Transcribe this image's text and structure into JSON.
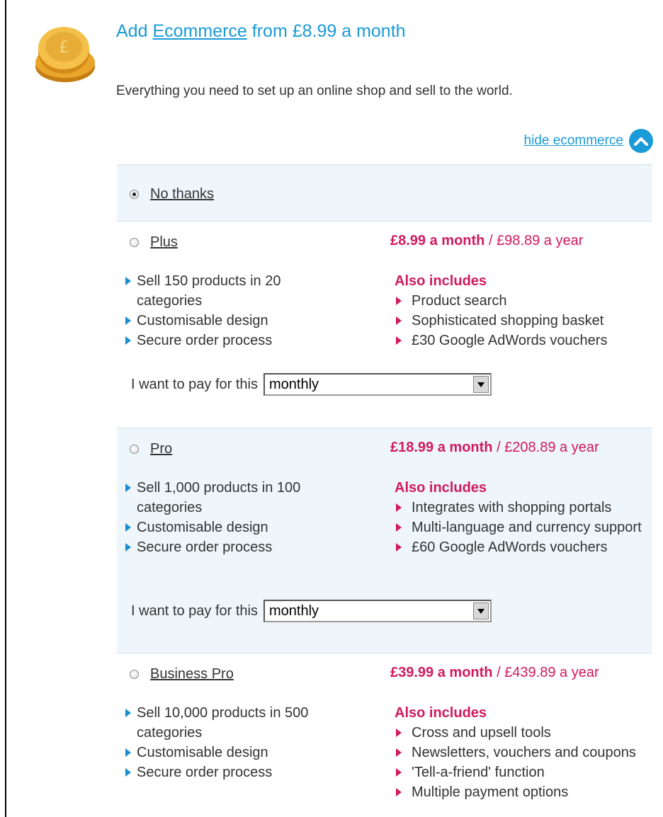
{
  "header": {
    "title_prefix": "Add",
    "title_link": "Ecommerce",
    "title_suffix": "from £8.99 a month",
    "intro": "Everything you need to set up an online shop and sell to the world.",
    "hide_link": "hide ecommerce"
  },
  "colors": {
    "accent_blue": "#1a9ad6",
    "price_pink": "#d11a5f",
    "panel_tint": "#eef6fb"
  },
  "options": {
    "no_thanks": {
      "label": "No thanks",
      "selected": true
    },
    "plus": {
      "label": "Plus",
      "price_month": "£8.99 a month",
      "price_sep": " / ",
      "price_year": "£98.89 a year",
      "features": [
        "Sell 150 products in 20 categories",
        "Customisable design",
        "Secure order process"
      ],
      "also_title": "Also includes",
      "also": [
        "Product search",
        "Sophisticated shopping basket",
        "£30 Google AdWords vouchers"
      ],
      "pay_label": "I want to pay for this",
      "pay_value": "monthly"
    },
    "pro": {
      "label": "Pro",
      "price_month": "£18.99 a month",
      "price_sep": " / ",
      "price_year": "£208.89 a year",
      "features": [
        "Sell 1,000 products in 100 categories",
        "Customisable design",
        "Secure order process"
      ],
      "also_title": "Also includes",
      "also": [
        "Integrates with shopping portals",
        "Multi-language and currency support",
        "£60 Google AdWords vouchers"
      ],
      "pay_label": "I want to pay for this",
      "pay_value": "monthly"
    },
    "business_pro": {
      "label": "Business Pro",
      "price_month": "£39.99 a month",
      "price_sep": " / ",
      "price_year": "£439.89 a year",
      "features": [
        "Sell 10,000 products in 500 categories",
        "Customisable design",
        "Secure order process"
      ],
      "also_title": "Also includes",
      "also": [
        "Cross and upsell tools",
        "Newsletters, vouchers and coupons",
        "'Tell-a-friend' function",
        "Multiple payment options"
      ]
    }
  }
}
